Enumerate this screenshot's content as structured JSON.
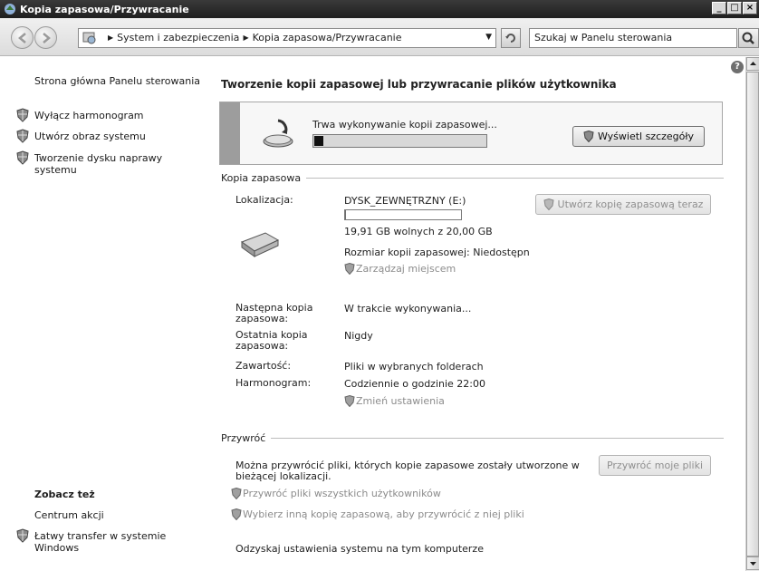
{
  "window": {
    "title": "Kopia zapasowa/Przywracanie"
  },
  "address": {
    "crumbs": [
      "System i zabezpieczenia",
      "Kopia zapasowa/Przywracanie"
    ],
    "search_placeholder": "Szukaj w Panelu sterowania"
  },
  "sidebar": {
    "home": "Strona główna Panelu sterowania",
    "tasks": [
      "Wyłącz harmonogram",
      "Utwórz obraz systemu",
      "Tworzenie dysku naprawy systemu"
    ],
    "see_also_title": "Zobacz też",
    "see_also": [
      "Centrum akcji",
      "Łatwy transfer w systemie Windows"
    ]
  },
  "main": {
    "heading": "Tworzenie kopii zapasowej lub przywracanie plików użytkownika",
    "progress": {
      "text": "Trwa wykonywanie kopii zapasowej...",
      "fraction": 0.03,
      "button": "Wyświetl szczegóły"
    },
    "backup": {
      "section": "Kopia zapasowa",
      "location_label": "Lokalizacja:",
      "location_value": "DYSK_ZEWNĘTRZNY (E:)",
      "disk_used_fraction": 0.0045,
      "free_space": "19,91 GB wolnych z 20,00 GB",
      "backup_size": "Rozmiar kopii zapasowej: Niedostępn",
      "manage_space": "Zarządzaj miejscem",
      "backup_now_button": "Utwórz kopię zapasową teraz",
      "next_label": "Następna kopia zapasowa:",
      "next_value": "W trakcie wykonywania...",
      "last_label": "Ostatnia kopia zapasowa:",
      "last_value": "Nigdy",
      "contents_label": "Zawartość:",
      "contents_value": "Pliki w wybranych folderach",
      "schedule_label": "Harmonogram:",
      "schedule_value": "Codziennie o godzinie 22:00",
      "change_settings": "Zmień ustawienia"
    },
    "restore": {
      "section": "Przywróć",
      "description": "Można przywrócić pliki, których kopie zapasowe zostały utworzone w bieżącej lokalizacji.",
      "restore_button": "Przywróć moje pliki",
      "restore_all": "Przywróć pliki wszystkich użytkowników",
      "choose_other": "Wybierz inną kopię zapasową, aby przywrócić z niej pliki",
      "recover_settings": "Odzyskaj ustawienia systemu na tym komputerze"
    }
  }
}
